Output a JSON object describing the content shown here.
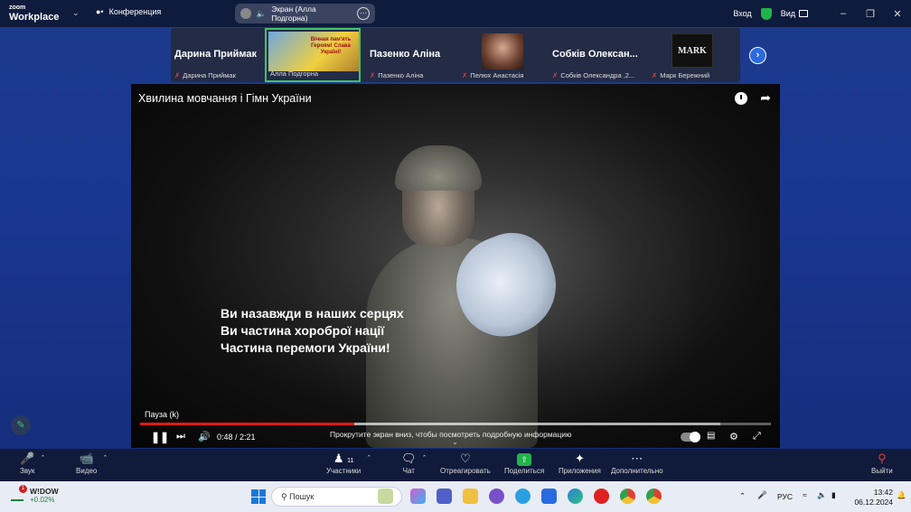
{
  "titlebar": {
    "brand_line1": "zoom",
    "brand_line2": "Workplace",
    "conference_label": "Конференция",
    "screen_share_label": "Экран (Алла Подгорна)",
    "login_label": "Вход",
    "view_label": "Вид"
  },
  "participants": [
    {
      "big_name": "Дарина Приймак",
      "name": "Дарина Приймак"
    },
    {
      "big_name": "",
      "name": "Алла Подгорна",
      "thumb_text": "Вічная пам'ять Героям! Слава Україні!"
    },
    {
      "big_name": "Пазенко Аліна",
      "name": "Пазенко Аліна"
    },
    {
      "big_name": "",
      "name": "Пелюх Анастасія"
    },
    {
      "big_name": "Собків Олексан...",
      "name": "Собків Олександра ,2..."
    },
    {
      "big_name": "",
      "name": "Марк Бережний",
      "thumb_text": "MARK"
    }
  ],
  "video": {
    "title": "Хвилина мовчання і Гімн України",
    "caption": [
      "Ви назавжди в наших серцях",
      "Ви частина хороброї нації",
      "Частина перемоги України!"
    ],
    "pause_label": "Пауза (k)",
    "current_time": "0:48",
    "duration": "2:21",
    "time_display": "0:48 / 2:21",
    "progress_fraction": 0.34,
    "buffered_fraction": 0.92,
    "hint": "Прокрутите экран вниз, чтобы посмотреть подробную информацию"
  },
  "toolbar": {
    "audio": "Звук",
    "video": "Видео",
    "participants": "Участники",
    "participants_count": "11",
    "chat": "Чат",
    "react": "Отреагировать",
    "share": "Поделиться",
    "apps": "Приложения",
    "more": "Дополнительно",
    "leave": "Выйти"
  },
  "taskbar": {
    "weather_ticker": "W!DOW",
    "weather_change": "+0.02%",
    "notification_count": "1",
    "search_placeholder": "Пошук",
    "language": "РУС",
    "time": "13:42",
    "date": "06.12.2024"
  },
  "colors": {
    "accent_green": "#21b34a",
    "progress_red": "#e01818",
    "zoom_blue": "#1a3790"
  }
}
